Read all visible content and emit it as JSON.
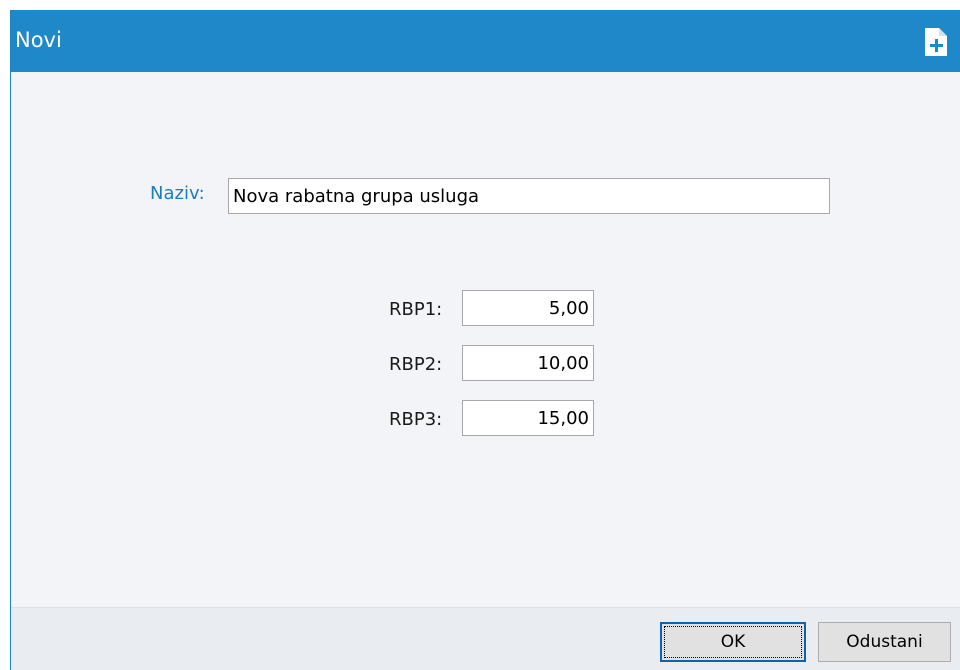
{
  "window": {
    "title": "Novi",
    "header_icon": "new-document-plus-icon",
    "accent_color": "#1e88c8"
  },
  "form": {
    "naziv": {
      "label": "Naziv:",
      "value": "Nova rabatna grupa usluga"
    },
    "rbp": [
      {
        "label": "RBP1:",
        "value": "5,00"
      },
      {
        "label": "RBP2:",
        "value": "10,00"
      },
      {
        "label": "RBP3:",
        "value": "15,00"
      }
    ]
  },
  "footer": {
    "ok_label": "OK",
    "cancel_label": "Odustani"
  }
}
